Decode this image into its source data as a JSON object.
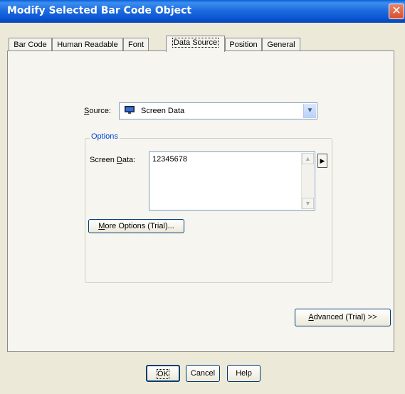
{
  "window": {
    "title": "Modify Selected Bar Code Object",
    "close_glyph": "✕"
  },
  "tabs": [
    {
      "label": "Bar Code"
    },
    {
      "label": "Human Readable"
    },
    {
      "label": "Font"
    },
    {
      "label": "Data Source",
      "active": true
    },
    {
      "label": "Position"
    },
    {
      "label": "General"
    }
  ],
  "source": {
    "label_access": "S",
    "label_rest": "ource:",
    "value": "Screen Data",
    "icon": "monitor-icon"
  },
  "options": {
    "group_title": "Options",
    "screen_data_label_pre": "Screen ",
    "screen_data_label_access": "D",
    "screen_data_label_post": "ata:",
    "screen_data_value": "12345678",
    "more_options_access": "M",
    "more_options_rest": "ore Options (Trial)..."
  },
  "advanced": {
    "access": "A",
    "rest": "dvanced (Trial) >>"
  },
  "footer": {
    "ok": "OK",
    "cancel": "Cancel",
    "help": "Help"
  },
  "colors": {
    "titlebar": "#0a55d2",
    "group_title": "#0046d5",
    "panel": "#f6f5f0",
    "dialog": "#ece9d8"
  }
}
